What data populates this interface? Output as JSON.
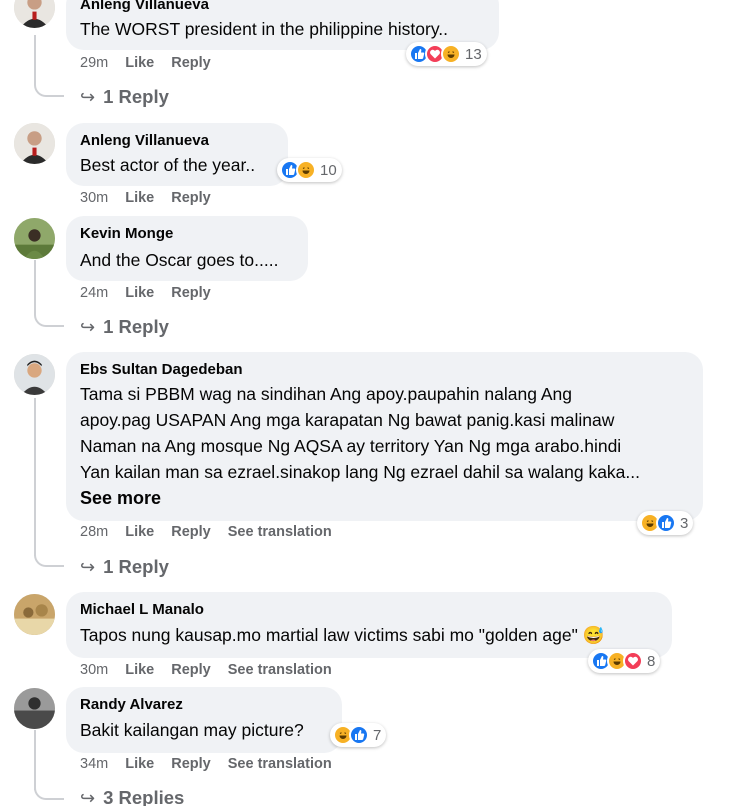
{
  "comments": [
    {
      "author": "Anleng Villanueva",
      "text": "The WORST president in the philippine history..",
      "time": "29m",
      "like": "Like",
      "reply": "Reply",
      "reactions": [
        "like",
        "love",
        "haha"
      ],
      "reaction_count": "13",
      "replies_label": "1 Reply"
    },
    {
      "author": "Anleng Villanueva",
      "text": "Best actor of the year..",
      "time": "30m",
      "like": "Like",
      "reply": "Reply",
      "reactions": [
        "like",
        "haha"
      ],
      "reaction_count": "10"
    },
    {
      "author": "Kevin Monge",
      "text": "And the Oscar goes to.....",
      "time": "24m",
      "like": "Like",
      "reply": "Reply",
      "replies_label": "1 Reply"
    },
    {
      "author": "Ebs Sultan Dagedeban",
      "text_lines": [
        "Tama si PBBM wag na sindihan Ang apoy.paupahin nalang Ang",
        "apoy.pag USAPAN Ang mga karapatan Ng bawat panig.kasi malinaw",
        "Naman na Ang mosque Ng AQSA ay territory Yan Ng mga arabo.hindi",
        "Yan kailan man sa ezrael.sinakop lang Ng ezrael dahil sa walang kaka..."
      ],
      "see_more": "See more",
      "time": "28m",
      "like": "Like",
      "reply": "Reply",
      "translate": "See translation",
      "reactions": [
        "haha",
        "like"
      ],
      "reaction_count": "3",
      "replies_label": "1 Reply"
    },
    {
      "author": "Michael L Manalo",
      "text": "Tapos nung kausap.mo martial law victims sabi mo \"golden age\" 😅",
      "time": "30m",
      "like": "Like",
      "reply": "Reply",
      "translate": "See translation",
      "reactions": [
        "like",
        "haha",
        "love"
      ],
      "reaction_count": "8"
    },
    {
      "author": "Randy Alvarez",
      "text": "Bakit kailangan may picture?",
      "time": "34m",
      "like": "Like",
      "reply": "Reply",
      "translate": "See translation",
      "reactions": [
        "haha",
        "like"
      ],
      "reaction_count": "7",
      "replies_label": "3 Replies"
    }
  ],
  "colors": {
    "bubble": "#f0f2f5",
    "meta": "#65676b",
    "like": "#1877f2",
    "love": "#f33e58",
    "haha": "#f7b125"
  },
  "icons": {
    "like": "thumbs-up-icon",
    "love": "heart-icon",
    "haha": "laughing-face-icon",
    "reply_arrow": "reply-arrow-icon"
  }
}
